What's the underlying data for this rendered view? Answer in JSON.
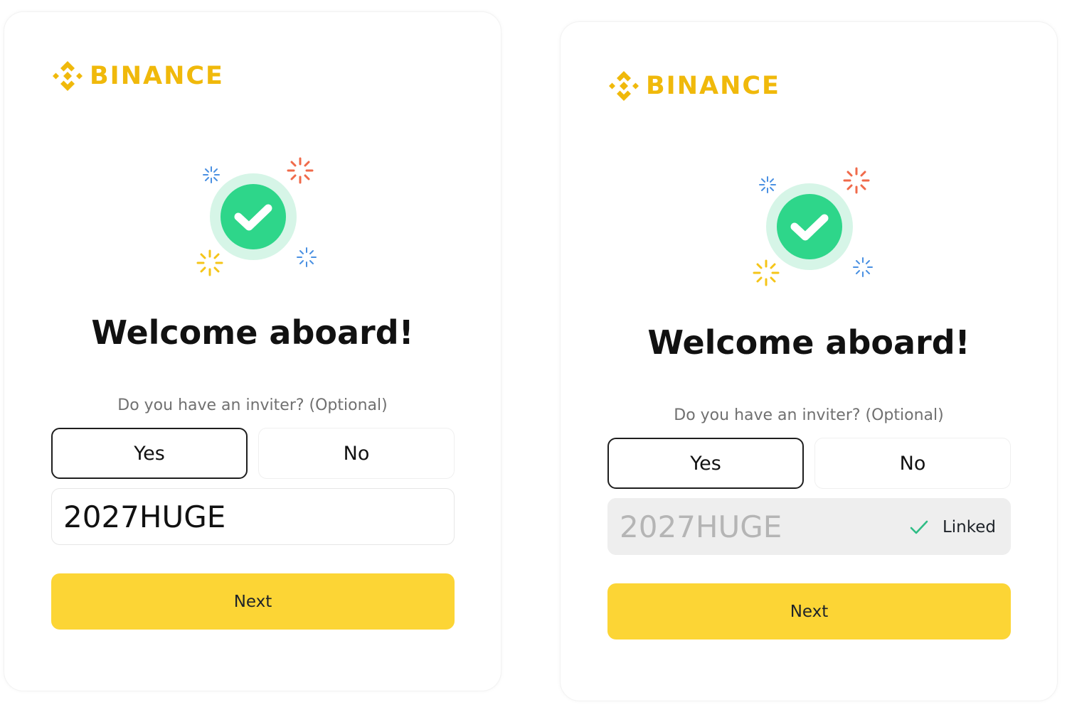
{
  "colors": {
    "brand": "#F0B90B",
    "button": "#FCD535",
    "success": "#2ED68A",
    "success_halo": "#D6F5E7"
  },
  "icons": {
    "logo": "binance-diamond-icon",
    "hero": "success-check-icon",
    "linked": "check-icon"
  },
  "left": {
    "brand": "BINANCE",
    "title": "Welcome aboard!",
    "question": "Do you have an inviter? (Optional)",
    "yes_label": "Yes",
    "no_label": "No",
    "code_value": "2027HUGE",
    "next_label": "Next"
  },
  "right": {
    "brand": "BINANCE",
    "title": "Welcome aboard!",
    "question": "Do you have an inviter? (Optional)",
    "yes_label": "Yes",
    "no_label": "No",
    "code_value": "2027HUGE",
    "linked_label": "Linked",
    "next_label": "Next"
  }
}
